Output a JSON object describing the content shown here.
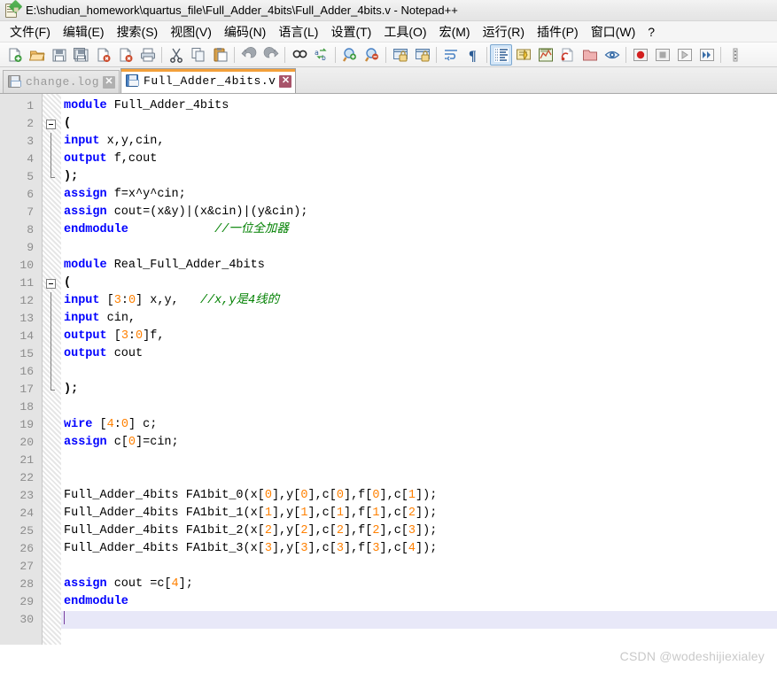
{
  "window": {
    "title": "E:\\shudian_homework\\quartus_file\\Full_Adder_4bits\\Full_Adder_4bits.v - Notepad++",
    "app_icon": "notepad-plus-plus-icon"
  },
  "menu": {
    "items": [
      {
        "label": "文件(F)",
        "name": "menu-file"
      },
      {
        "label": "编辑(E)",
        "name": "menu-edit"
      },
      {
        "label": "搜索(S)",
        "name": "menu-search"
      },
      {
        "label": "视图(V)",
        "name": "menu-view"
      },
      {
        "label": "编码(N)",
        "name": "menu-encoding"
      },
      {
        "label": "语言(L)",
        "name": "menu-language"
      },
      {
        "label": "设置(T)",
        "name": "menu-settings"
      },
      {
        "label": "工具(O)",
        "name": "menu-tools"
      },
      {
        "label": "宏(M)",
        "name": "menu-macro"
      },
      {
        "label": "运行(R)",
        "name": "menu-run"
      },
      {
        "label": "插件(P)",
        "name": "menu-plugins"
      },
      {
        "label": "窗口(W)",
        "name": "menu-window"
      },
      {
        "label": "?",
        "name": "menu-help"
      }
    ]
  },
  "toolbar": {
    "buttons": [
      {
        "icon": "new-file-icon"
      },
      {
        "icon": "open-file-icon"
      },
      {
        "icon": "save-icon"
      },
      {
        "icon": "save-all-icon"
      },
      {
        "icon": "close-file-icon"
      },
      {
        "icon": "close-all-icon"
      },
      {
        "icon": "print-icon"
      },
      {
        "separator": true
      },
      {
        "icon": "cut-icon"
      },
      {
        "icon": "copy-icon"
      },
      {
        "icon": "paste-icon"
      },
      {
        "separator": true
      },
      {
        "icon": "undo-icon"
      },
      {
        "icon": "redo-icon"
      },
      {
        "separator": true
      },
      {
        "icon": "find-icon"
      },
      {
        "icon": "replace-icon"
      },
      {
        "separator": true
      },
      {
        "icon": "zoom-in-icon"
      },
      {
        "icon": "zoom-out-icon"
      },
      {
        "separator": true
      },
      {
        "icon": "sync-vertical-scroll-icon"
      },
      {
        "icon": "sync-horizontal-scroll-icon"
      },
      {
        "separator": true
      },
      {
        "icon": "word-wrap-icon"
      },
      {
        "icon": "show-all-characters-icon"
      },
      {
        "separator": true
      },
      {
        "icon": "indent-guideline-icon",
        "active": true
      },
      {
        "icon": "user-defined-language-icon"
      },
      {
        "icon": "document-map-icon"
      },
      {
        "icon": "function-list-icon"
      },
      {
        "icon": "folder-as-workspace-icon"
      },
      {
        "icon": "monitoring-icon"
      },
      {
        "separator": true
      },
      {
        "icon": "record-macro-icon"
      },
      {
        "icon": "stop-macro-icon"
      },
      {
        "icon": "play-macro-icon"
      },
      {
        "icon": "run-macro-multiple-icon"
      },
      {
        "separator": true
      },
      {
        "icon": "more-icon"
      }
    ]
  },
  "tabs": [
    {
      "label": "change.log",
      "active": false,
      "icon": "floppy-icon",
      "close": "✕",
      "name": "tab-change-log"
    },
    {
      "label": "Full_Adder_4bits.v",
      "active": true,
      "icon": "floppy-icon",
      "close": "✕",
      "name": "tab-full-adder-4bits-v"
    }
  ],
  "editor": {
    "current_line": 30,
    "total_lines": 30,
    "line_numbers": [
      1,
      2,
      3,
      4,
      5,
      6,
      7,
      8,
      9,
      10,
      11,
      12,
      13,
      14,
      15,
      16,
      17,
      18,
      19,
      20,
      21,
      22,
      23,
      24,
      25,
      26,
      27,
      28,
      29,
      30
    ],
    "lines": [
      {
        "n": 1,
        "tokens": [
          {
            "t": "kw",
            "v": "module"
          },
          {
            "t": "pl",
            "v": " Full_Adder_4bits"
          }
        ]
      },
      {
        "n": 2,
        "fold": "start",
        "tokens": [
          {
            "t": "op",
            "v": "("
          }
        ]
      },
      {
        "n": 3,
        "fold": "body",
        "tokens": [
          {
            "t": "kw",
            "v": "input"
          },
          {
            "t": "pl",
            "v": " x,y,cin,"
          }
        ]
      },
      {
        "n": 4,
        "fold": "body",
        "tokens": [
          {
            "t": "kw",
            "v": "output"
          },
          {
            "t": "pl",
            "v": " f,cout"
          }
        ]
      },
      {
        "n": 5,
        "fold": "end",
        "tokens": [
          {
            "t": "op",
            "v": ");"
          }
        ]
      },
      {
        "n": 6,
        "tokens": [
          {
            "t": "kw",
            "v": "assign"
          },
          {
            "t": "pl",
            "v": " f=x^y^cin;"
          }
        ]
      },
      {
        "n": 7,
        "tokens": [
          {
            "t": "kw",
            "v": "assign"
          },
          {
            "t": "pl",
            "v": " cout=(x&y)|(x&cin)|(y&cin);"
          }
        ]
      },
      {
        "n": 8,
        "tokens": [
          {
            "t": "kw",
            "v": "endmodule"
          },
          {
            "t": "pl",
            "v": "            "
          },
          {
            "t": "cmt",
            "v": "//一位全加器"
          }
        ]
      },
      {
        "n": 9,
        "tokens": []
      },
      {
        "n": 10,
        "tokens": [
          {
            "t": "kw",
            "v": "module"
          },
          {
            "t": "pl",
            "v": " Real_Full_Adder_4bits"
          }
        ]
      },
      {
        "n": 11,
        "fold": "start",
        "tokens": [
          {
            "t": "op",
            "v": "("
          }
        ]
      },
      {
        "n": 12,
        "fold": "body",
        "tokens": [
          {
            "t": "kw",
            "v": "input"
          },
          {
            "t": "pl",
            "v": " ["
          },
          {
            "t": "num",
            "v": "3"
          },
          {
            "t": "pl",
            "v": ":"
          },
          {
            "t": "num",
            "v": "0"
          },
          {
            "t": "pl",
            "v": "] x,y,   "
          },
          {
            "t": "cmt",
            "v": "//x,y是4线的"
          }
        ]
      },
      {
        "n": 13,
        "fold": "body",
        "tokens": [
          {
            "t": "kw",
            "v": "input"
          },
          {
            "t": "pl",
            "v": " cin,"
          }
        ]
      },
      {
        "n": 14,
        "fold": "body",
        "tokens": [
          {
            "t": "kw",
            "v": "output"
          },
          {
            "t": "pl",
            "v": " ["
          },
          {
            "t": "num",
            "v": "3"
          },
          {
            "t": "pl",
            "v": ":"
          },
          {
            "t": "num",
            "v": "0"
          },
          {
            "t": "pl",
            "v": "]f,"
          }
        ]
      },
      {
        "n": 15,
        "fold": "body",
        "tokens": [
          {
            "t": "kw",
            "v": "output"
          },
          {
            "t": "pl",
            "v": " cout"
          }
        ]
      },
      {
        "n": 16,
        "fold": "body",
        "tokens": []
      },
      {
        "n": 17,
        "fold": "end",
        "tokens": [
          {
            "t": "op",
            "v": ");"
          }
        ]
      },
      {
        "n": 18,
        "tokens": []
      },
      {
        "n": 19,
        "tokens": [
          {
            "t": "kw",
            "v": "wire"
          },
          {
            "t": "pl",
            "v": " ["
          },
          {
            "t": "num",
            "v": "4"
          },
          {
            "t": "pl",
            "v": ":"
          },
          {
            "t": "num",
            "v": "0"
          },
          {
            "t": "pl",
            "v": "] c;"
          }
        ]
      },
      {
        "n": 20,
        "tokens": [
          {
            "t": "kw",
            "v": "assign"
          },
          {
            "t": "pl",
            "v": " c["
          },
          {
            "t": "num",
            "v": "0"
          },
          {
            "t": "pl",
            "v": "]=cin;"
          }
        ]
      },
      {
        "n": 21,
        "tokens": []
      },
      {
        "n": 22,
        "tokens": []
      },
      {
        "n": 23,
        "tokens": [
          {
            "t": "pl",
            "v": "Full_Adder_4bits FA1bit_0(x["
          },
          {
            "t": "num",
            "v": "0"
          },
          {
            "t": "pl",
            "v": "],y["
          },
          {
            "t": "num",
            "v": "0"
          },
          {
            "t": "pl",
            "v": "],c["
          },
          {
            "t": "num",
            "v": "0"
          },
          {
            "t": "pl",
            "v": "],f["
          },
          {
            "t": "num",
            "v": "0"
          },
          {
            "t": "pl",
            "v": "],c["
          },
          {
            "t": "num",
            "v": "1"
          },
          {
            "t": "pl",
            "v": "]);"
          }
        ]
      },
      {
        "n": 24,
        "tokens": [
          {
            "t": "pl",
            "v": "Full_Adder_4bits FA1bit_1(x["
          },
          {
            "t": "num",
            "v": "1"
          },
          {
            "t": "pl",
            "v": "],y["
          },
          {
            "t": "num",
            "v": "1"
          },
          {
            "t": "pl",
            "v": "],c["
          },
          {
            "t": "num",
            "v": "1"
          },
          {
            "t": "pl",
            "v": "],f["
          },
          {
            "t": "num",
            "v": "1"
          },
          {
            "t": "pl",
            "v": "],c["
          },
          {
            "t": "num",
            "v": "2"
          },
          {
            "t": "pl",
            "v": "]);"
          }
        ]
      },
      {
        "n": 25,
        "tokens": [
          {
            "t": "pl",
            "v": "Full_Adder_4bits FA1bit_2(x["
          },
          {
            "t": "num",
            "v": "2"
          },
          {
            "t": "pl",
            "v": "],y["
          },
          {
            "t": "num",
            "v": "2"
          },
          {
            "t": "pl",
            "v": "],c["
          },
          {
            "t": "num",
            "v": "2"
          },
          {
            "t": "pl",
            "v": "],f["
          },
          {
            "t": "num",
            "v": "2"
          },
          {
            "t": "pl",
            "v": "],c["
          },
          {
            "t": "num",
            "v": "3"
          },
          {
            "t": "pl",
            "v": "]);"
          }
        ]
      },
      {
        "n": 26,
        "tokens": [
          {
            "t": "pl",
            "v": "Full_Adder_4bits FA1bit_3(x["
          },
          {
            "t": "num",
            "v": "3"
          },
          {
            "t": "pl",
            "v": "],y["
          },
          {
            "t": "num",
            "v": "3"
          },
          {
            "t": "pl",
            "v": "],c["
          },
          {
            "t": "num",
            "v": "3"
          },
          {
            "t": "pl",
            "v": "],f["
          },
          {
            "t": "num",
            "v": "3"
          },
          {
            "t": "pl",
            "v": "],c["
          },
          {
            "t": "num",
            "v": "4"
          },
          {
            "t": "pl",
            "v": "]);"
          }
        ]
      },
      {
        "n": 27,
        "tokens": []
      },
      {
        "n": 28,
        "tokens": [
          {
            "t": "kw",
            "v": "assign"
          },
          {
            "t": "pl",
            "v": " cout ="
          },
          {
            "t": "pl",
            "v": "c["
          },
          {
            "t": "num",
            "v": "4"
          },
          {
            "t": "pl",
            "v": "];"
          }
        ]
      },
      {
        "n": 29,
        "tokens": [
          {
            "t": "kw",
            "v": "endmodule"
          }
        ]
      },
      {
        "n": 30,
        "tokens": [],
        "current": true,
        "caret": true
      }
    ]
  },
  "watermark": {
    "text": "CSDN @wodeshijiexialey"
  },
  "colors": {
    "keyword": "#0000ff",
    "number": "#ff8000",
    "comment": "#008000",
    "plain": "#000000",
    "active_tab_accent": "#f3a03a",
    "current_line_bg": "#e8e8f8",
    "caret": "#7a3fa0"
  }
}
